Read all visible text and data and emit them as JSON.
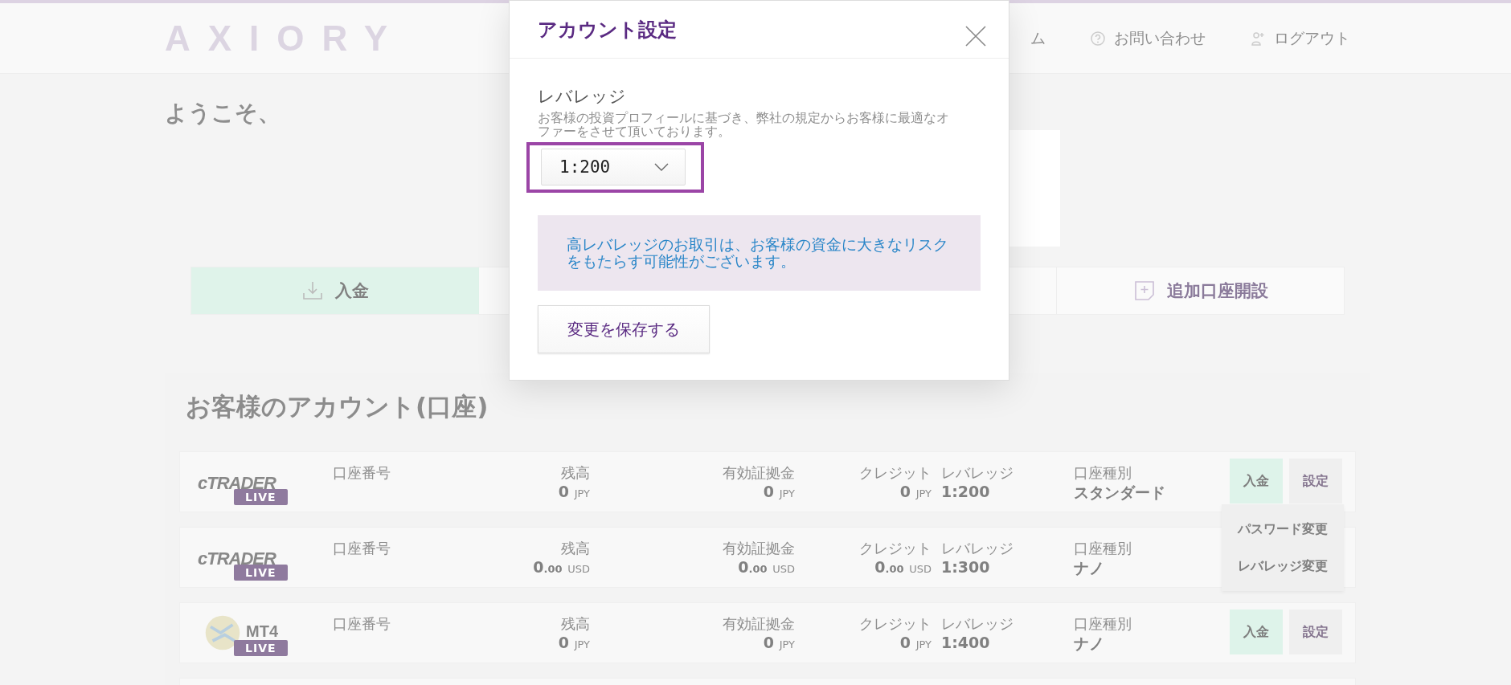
{
  "header": {
    "logo": "AXIORY",
    "nav": [
      {
        "label": "ム",
        "kind": "plain"
      },
      {
        "label": "お問い合わせ",
        "kind": "help"
      },
      {
        "label": "ログアウト",
        "kind": "logout"
      }
    ]
  },
  "welcome": "ようこそ、",
  "actions": [
    {
      "label": "入金",
      "kind": "deposit"
    },
    {
      "label": "追加口座開設",
      "kind": "add"
    }
  ],
  "accounts": {
    "title": "お客様のアカウント(口座)",
    "rows": [
      {
        "kind": "ctrader",
        "logo_text": "cTRADER",
        "badge": "LIVE",
        "number_label": "口座番号",
        "balance": {
          "label": "残高",
          "value": "0",
          "currency": "JPY"
        },
        "equity": {
          "label": "有効証拠金",
          "value": "0",
          "currency": "JPY"
        },
        "credit": {
          "label": "クレジット",
          "value": "0",
          "currency": "JPY"
        },
        "leverage": {
          "label": "レバレッジ",
          "value": "1:200"
        },
        "type": {
          "label": "口座種別",
          "value": "スタンダード"
        },
        "buttons": [
          "入金",
          "設定"
        ]
      },
      {
        "kind": "ctrader",
        "logo_text": "cTRADER",
        "badge": "LIVE",
        "number_label": "口座番号",
        "balance": {
          "label": "残高",
          "value": "0",
          "decimals": ".00",
          "currency": "USD"
        },
        "equity": {
          "label": "有効証拠金",
          "value": "0",
          "decimals": ".00",
          "currency": "USD"
        },
        "credit": {
          "label": "クレジット",
          "value": "0",
          "decimals": ".00",
          "currency": "USD"
        },
        "leverage": {
          "label": "レバレッジ",
          "value": "1:300"
        },
        "type": {
          "label": "口座種別",
          "value": "ナノ"
        }
      },
      {
        "kind": "mt4",
        "logo_text": "MT4",
        "badge": "LIVE",
        "number_label": "口座番号",
        "balance": {
          "label": "残高",
          "value": "0",
          "currency": "JPY"
        },
        "equity": {
          "label": "有効証拠金",
          "value": "0",
          "currency": "JPY"
        },
        "credit": {
          "label": "クレジット",
          "value": "0",
          "currency": "JPY"
        },
        "leverage": {
          "label": "レバレッジ",
          "value": "1:400"
        },
        "type": {
          "label": "口座種別",
          "value": "ナノ"
        },
        "buttons": [
          "入金",
          "設定"
        ]
      }
    ]
  },
  "menu": {
    "items": [
      "パスワード変更",
      "レバレッジ変更"
    ]
  },
  "modal": {
    "title": "アカウント設定",
    "field_label": "レバレッジ",
    "description": "お客様の投資プロフィールに基づき、弊社の規定からお客様に最適なオファーをさせて頂いております。",
    "select": {
      "value": "1:200",
      "highlighted": true
    },
    "warning": "高レバレッジのお取引は、お客様の資金に大きなリスクをもたらす可能性がございます。",
    "save_button": "変更を保存する"
  }
}
